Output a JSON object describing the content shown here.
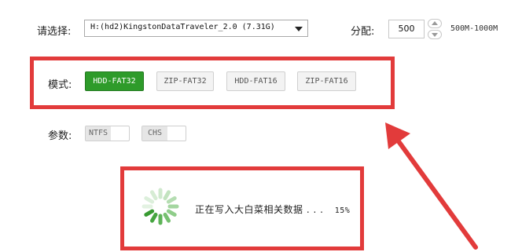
{
  "row1": {
    "select_label": "请选择:",
    "device": "H:(hd2)KingstonDataTraveler_2.0 (7.31G)",
    "alloc_label": "分配:",
    "alloc_value": "500",
    "alloc_range": "500M-1000M"
  },
  "mode": {
    "label": "模式:",
    "options": [
      "HDD-FAT32",
      "ZIP-FAT32",
      "HDD-FAT16",
      "ZIP-FAT16"
    ],
    "selected": "HDD-FAT32"
  },
  "params": {
    "label": "参数:",
    "toggles": [
      {
        "label": "NTFS",
        "on": false
      },
      {
        "label": "CHS",
        "on": false
      }
    ]
  },
  "progress": {
    "status": "正在写入大白菜相关数据 . . .",
    "percent_text": "15%",
    "percent": 15
  },
  "colors": {
    "highlight_red": "#e23b3b",
    "active_green": "#2e9b2a"
  }
}
